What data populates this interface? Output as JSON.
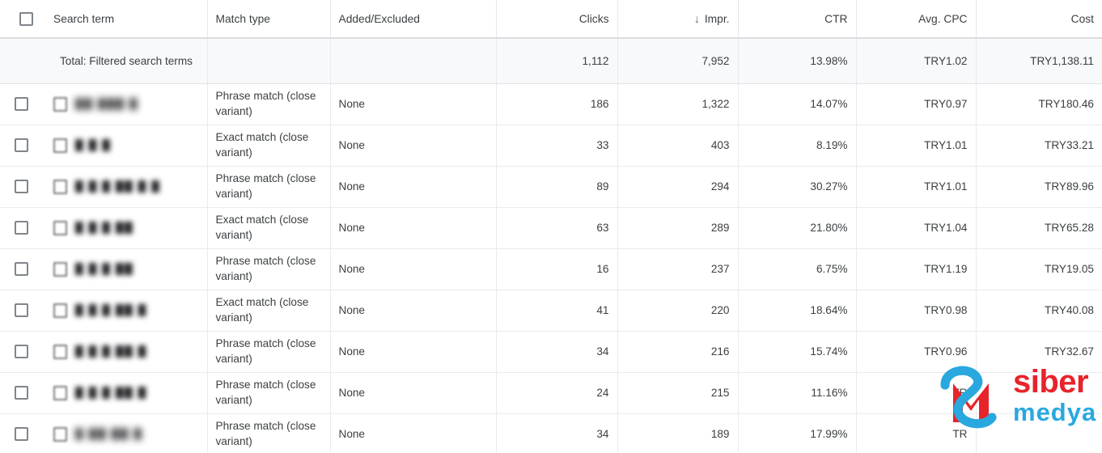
{
  "table": {
    "columns": [
      {
        "key": "checkbox",
        "label": "",
        "align": "left"
      },
      {
        "key": "search_term",
        "label": "Search term",
        "align": "left"
      },
      {
        "key": "match_type",
        "label": "Match type",
        "align": "left"
      },
      {
        "key": "added_excluded",
        "label": "Added/Excluded",
        "align": "left"
      },
      {
        "key": "clicks",
        "label": "Clicks",
        "align": "right"
      },
      {
        "key": "impr",
        "label": "Impr.",
        "align": "right",
        "sort": "desc",
        "sort_icon": "arrow-down-icon"
      },
      {
        "key": "ctr",
        "label": "CTR",
        "align": "right"
      },
      {
        "key": "avg_cpc",
        "label": "Avg. CPC",
        "align": "right"
      },
      {
        "key": "cost",
        "label": "Cost",
        "align": "right"
      }
    ],
    "select_all_checkbox": {
      "checked": false
    },
    "totals": {
      "label": "Total: Filtered search terms",
      "match_type": "",
      "added_excluded": "",
      "clicks": "1,112",
      "impr": "7,952",
      "ctr": "13.98%",
      "avg_cpc": "TRY1.02",
      "cost": "TRY1,138.11"
    },
    "rows": [
      {
        "search_term": "██ ███ █",
        "search_term_redacted": true,
        "match_type": "Phrase match (close variant)",
        "added_excluded": "None",
        "clicks": "186",
        "impr": "1,322",
        "ctr": "14.07%",
        "avg_cpc": "TRY0.97",
        "cost": "TRY180.46"
      },
      {
        "search_term": "█ █ █",
        "search_term_redacted": true,
        "match_type": "Exact match (close variant)",
        "added_excluded": "None",
        "clicks": "33",
        "impr": "403",
        "ctr": "8.19%",
        "avg_cpc": "TRY1.01",
        "cost": "TRY33.21"
      },
      {
        "search_term": "█ █ █ ██ █ █",
        "search_term_redacted": true,
        "match_type": "Phrase match (close variant)",
        "added_excluded": "None",
        "clicks": "89",
        "impr": "294",
        "ctr": "30.27%",
        "avg_cpc": "TRY1.01",
        "cost": "TRY89.96"
      },
      {
        "search_term": "█ █ █ ██",
        "search_term_redacted": true,
        "match_type": "Exact match (close variant)",
        "added_excluded": "None",
        "clicks": "63",
        "impr": "289",
        "ctr": "21.80%",
        "avg_cpc": "TRY1.04",
        "cost": "TRY65.28"
      },
      {
        "search_term": "█ █ █ ██",
        "search_term_redacted": true,
        "match_type": "Phrase match (close variant)",
        "added_excluded": "None",
        "clicks": "16",
        "impr": "237",
        "ctr": "6.75%",
        "avg_cpc": "TRY1.19",
        "cost": "TRY19.05"
      },
      {
        "search_term": "█ █ █ ██  █",
        "search_term_redacted": true,
        "match_type": "Exact match (close variant)",
        "added_excluded": "None",
        "clicks": "41",
        "impr": "220",
        "ctr": "18.64%",
        "avg_cpc": "TRY0.98",
        "cost": "TRY40.08"
      },
      {
        "search_term": "█ █ █ ██  █",
        "search_term_redacted": true,
        "match_type": "Phrase match (close variant)",
        "added_excluded": "None",
        "clicks": "34",
        "impr": "216",
        "ctr": "15.74%",
        "avg_cpc": "TRY0.96",
        "cost": "TRY32.67"
      },
      {
        "search_term": "█ █ █ ██  █",
        "search_term_redacted": true,
        "match_type": "Phrase match (close variant)",
        "added_excluded": "None",
        "clicks": "24",
        "impr": "215",
        "ctr": "11.16%",
        "avg_cpc": "TR",
        "avg_cpc_obscured": true,
        "cost": "",
        "cost_obscured": true
      },
      {
        "search_term": "█ ██ ██  █",
        "search_term_redacted": true,
        "match_type": "Phrase match (close variant)",
        "added_excluded": "None",
        "clicks": "34",
        "impr": "189",
        "ctr": "17.99%",
        "avg_cpc": "TR",
        "avg_cpc_obscured": true,
        "cost": "",
        "cost_obscured": true
      }
    ]
  },
  "watermark": {
    "name": "siber-medya-logo",
    "text_primary": "siber",
    "text_secondary": "medya",
    "color_primary": "#e8232a",
    "color_secondary": "#29a8df"
  },
  "colors": {
    "text": "#3c4043",
    "grid_line": "#e8eaed",
    "header_border": "#dadce0",
    "totals_bg": "#f8f9fa",
    "checkbox_border": "#80868b"
  }
}
